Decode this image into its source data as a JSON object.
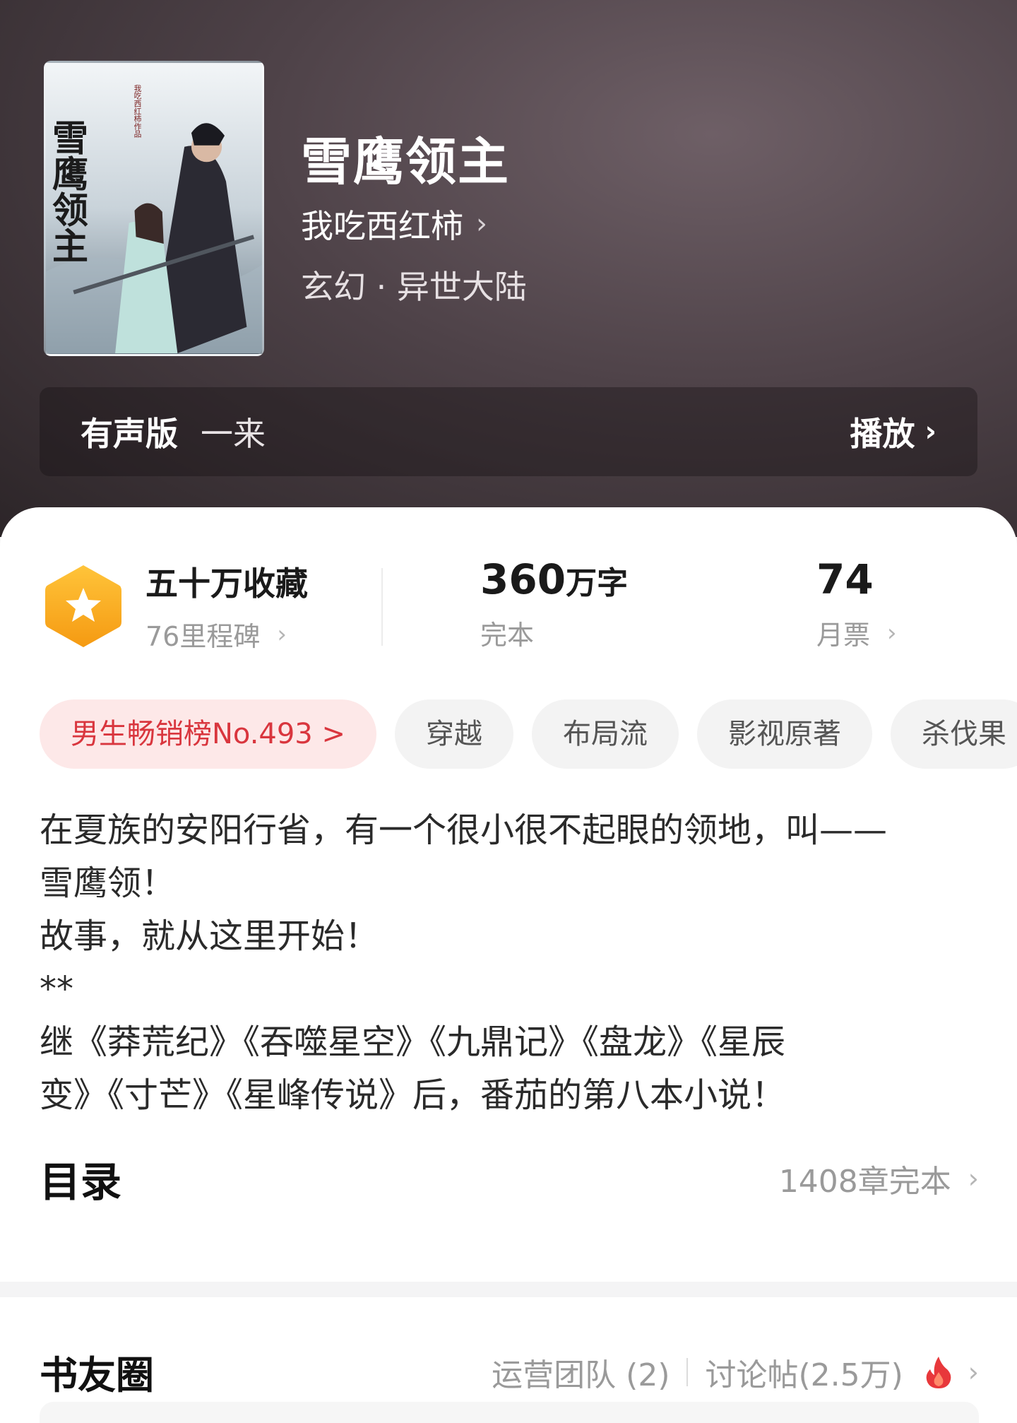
{
  "book": {
    "title": "雪鹰领主",
    "author": "我吃西红柿",
    "genre": "玄幻 · 异世大陆",
    "cover": {
      "printed_title": "雪鹰领主",
      "printed_author": "我吃西红柿作品"
    }
  },
  "audio": {
    "label": "有声版",
    "narrator": "一来",
    "action": "播放"
  },
  "stats": {
    "collect": {
      "main": "五十万收藏",
      "sub": "76里程碑"
    },
    "words": {
      "number": "360",
      "unit": "万字",
      "sub": "完本"
    },
    "tickets": {
      "number": "74",
      "sub": "月票"
    }
  },
  "tags": [
    "男生畅销榜No.493 >",
    "穿越",
    "布局流",
    "影视原著",
    "杀伐果"
  ],
  "description": "在夏族的安阳行省，有一个很小很不起眼的领地，叫——\n雪鹰领！\n故事，就从这里开始！\n**\n继《莽荒纪》《吞噬星空》《九鼎记》《盘龙》《星辰\n变》《寸芒》《星峰传说》后，番茄的第八本小说！",
  "toc": {
    "title": "目录",
    "info": "1408章完本"
  },
  "circle": {
    "title": "书友圈",
    "team": "运营团队 (2)",
    "posts": "讨论帖(2.5万)"
  },
  "icons": {
    "chevron": "›",
    "fire": "fire-icon",
    "star_badge": "star-badge-icon"
  },
  "colors": {
    "rank_tag_bg": "#fde8e8",
    "rank_tag_text": "#d9363e",
    "badge": "#f7a823",
    "fire": "#e8383b"
  }
}
